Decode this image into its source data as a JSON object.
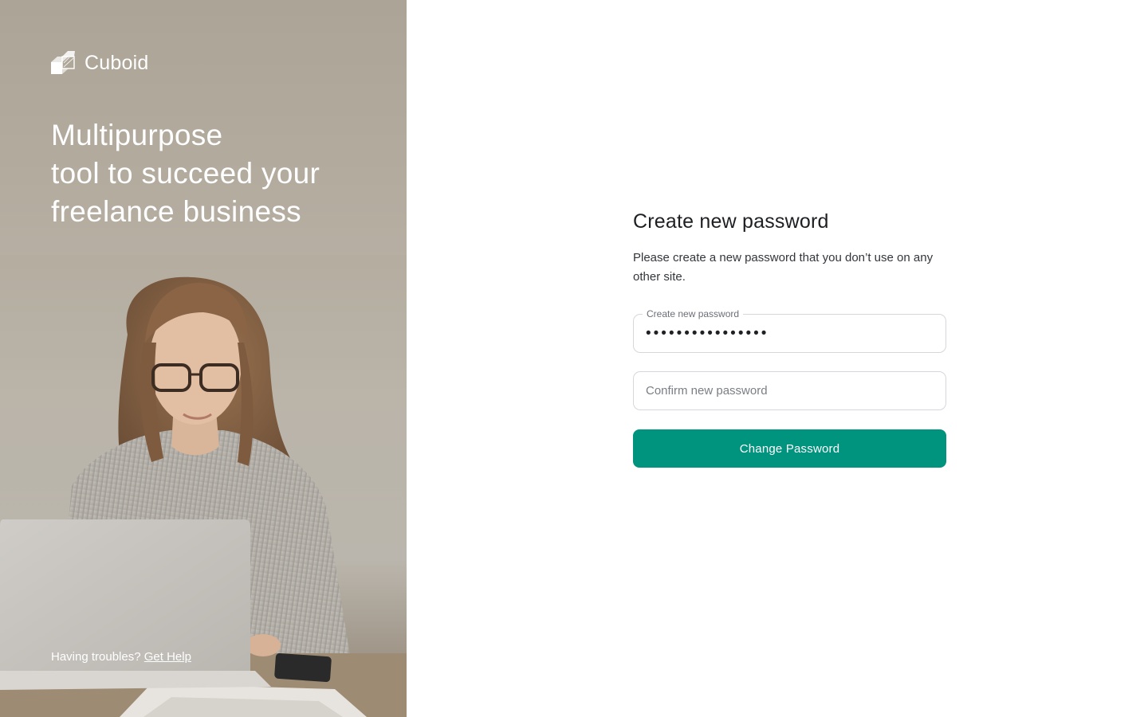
{
  "brand": {
    "name": "Cuboid",
    "logo_icon": "cube-logo-icon"
  },
  "hero": {
    "headline_lines": [
      "Multipurpose",
      "tool to succeed your",
      "freelance business"
    ],
    "photo": "woman-with-laptop-photo",
    "help_text": "Having troubles?",
    "help_link": "Get Help"
  },
  "form": {
    "title": "Create new password",
    "description": "Please create a new password that you don’t use on any other site.",
    "new_password": {
      "label": "Create new password",
      "value": "••••••••••••••••"
    },
    "confirm_password": {
      "placeholder": "Confirm new password",
      "value": ""
    },
    "submit_label": "Change Password"
  },
  "colors": {
    "accent": "#00937e",
    "title": "#1d1f22",
    "border": "#d5d7db",
    "hero_text": "#ffffff"
  }
}
